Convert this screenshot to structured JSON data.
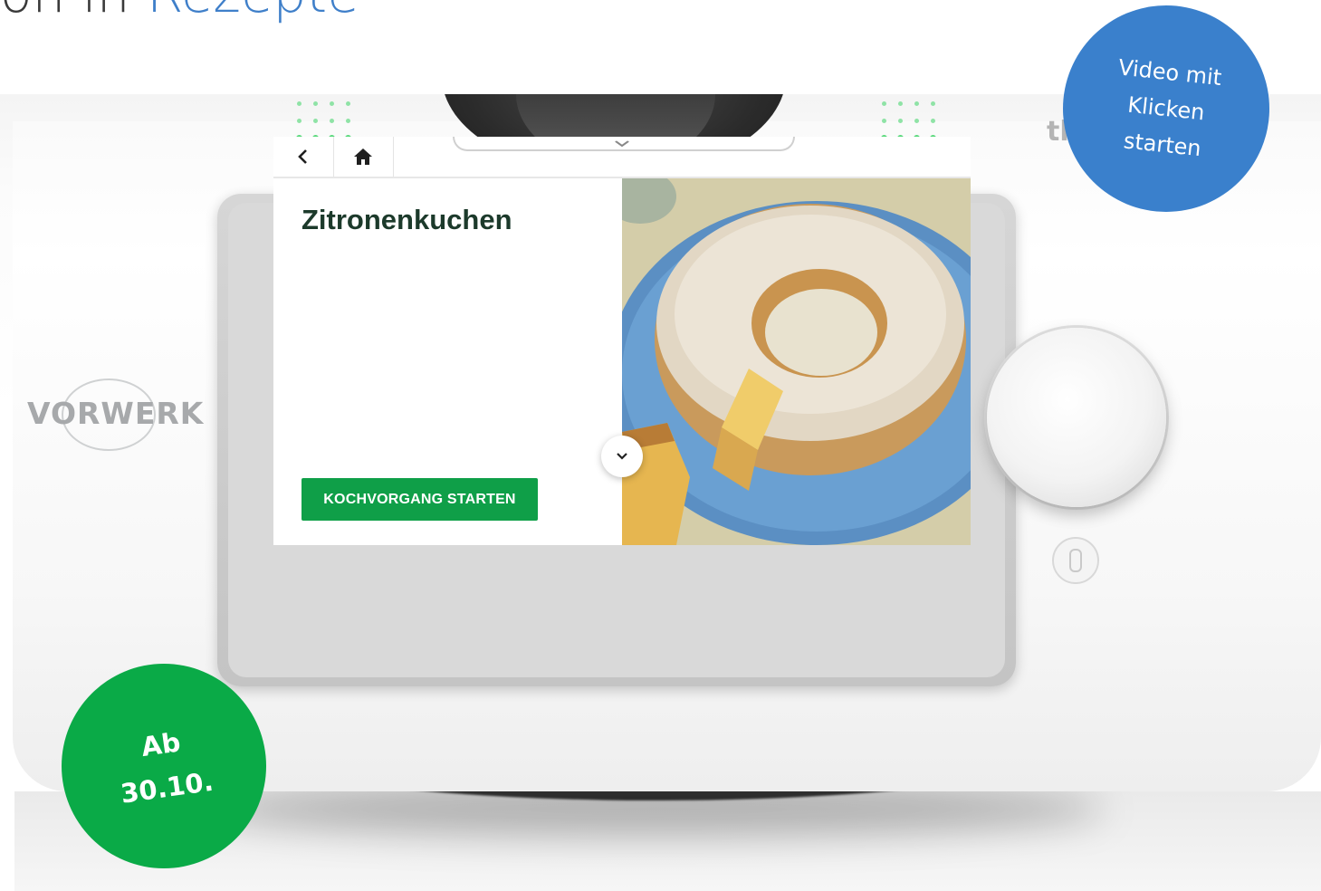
{
  "header": {
    "heading_prefix": "on in",
    "heading_accent": "Rezepte"
  },
  "device": {
    "brand": "VORWERK",
    "brand_mark": "tl"
  },
  "screen": {
    "back_icon": "chevron-left-icon",
    "home_icon": "home-icon",
    "pull_down_icon": "chevron-down-icon",
    "recipe_title": "Zitronenkuchen",
    "start_button_label": "KOCHVORGANG STARTEN",
    "expand_icon": "chevron-down-icon",
    "photo_subject": "Zitronenkuchen"
  },
  "badges": {
    "video": "Video mit\nKlicken\nstarten",
    "date": "Ab\n30.10."
  },
  "colors": {
    "accent_blue": "#3a80cc",
    "accent_green": "#0aaa47",
    "button_green": "#0f9f48",
    "title_dark_green": "#1c3a2b",
    "led_green": "#47d16a"
  }
}
